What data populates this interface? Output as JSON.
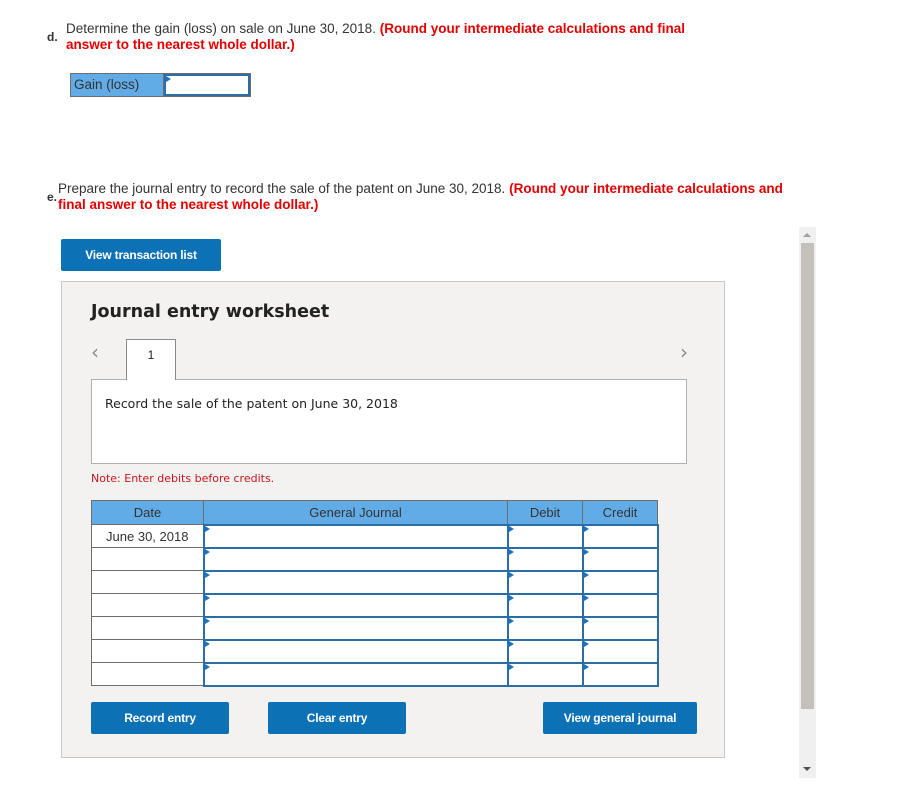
{
  "part_d": {
    "letter": "d.",
    "prompt": "Determine the gain (loss) on sale on June 30, 2018.",
    "instruction": "(Round your intermediate calculations and final answer to the nearest whole dollar.)",
    "field_label": "Gain (loss)",
    "field_value": ""
  },
  "part_e": {
    "letter": "e.",
    "prompt": "Prepare the journal entry to record the sale of the patent on June 30, 2018.",
    "instruction": "(Round your intermediate calculations and final answer to the nearest whole dollar.)",
    "view_transaction_list_label": "View transaction list"
  },
  "worksheet": {
    "title": "Journal entry worksheet",
    "prev_icon": "‹",
    "next_icon": "›",
    "tabs": [
      {
        "label": "1"
      }
    ],
    "description": "Record the sale of the patent on June 30, 2018",
    "note": "Note: Enter debits before credits.",
    "columns": {
      "date": "Date",
      "general_journal": "General Journal",
      "debit": "Debit",
      "credit": "Credit"
    },
    "rows": [
      {
        "date": "June 30, 2018",
        "account": "",
        "debit": "",
        "credit": ""
      },
      {
        "date": "",
        "account": "",
        "debit": "",
        "credit": ""
      },
      {
        "date": "",
        "account": "",
        "debit": "",
        "credit": ""
      },
      {
        "date": "",
        "account": "",
        "debit": "",
        "credit": ""
      },
      {
        "date": "",
        "account": "",
        "debit": "",
        "credit": ""
      },
      {
        "date": "",
        "account": "",
        "debit": "",
        "credit": ""
      },
      {
        "date": "",
        "account": "",
        "debit": "",
        "credit": ""
      }
    ],
    "buttons": {
      "record_entry": "Record entry",
      "clear_entry": "Clear entry",
      "view_general_journal": "View general journal"
    }
  },
  "colors": {
    "accent_button": "#0d71b5",
    "header_blue": "#61ace6",
    "instruction_red": "#e20000",
    "note_red": "#c4161c",
    "input_border": "#2b6da5"
  }
}
